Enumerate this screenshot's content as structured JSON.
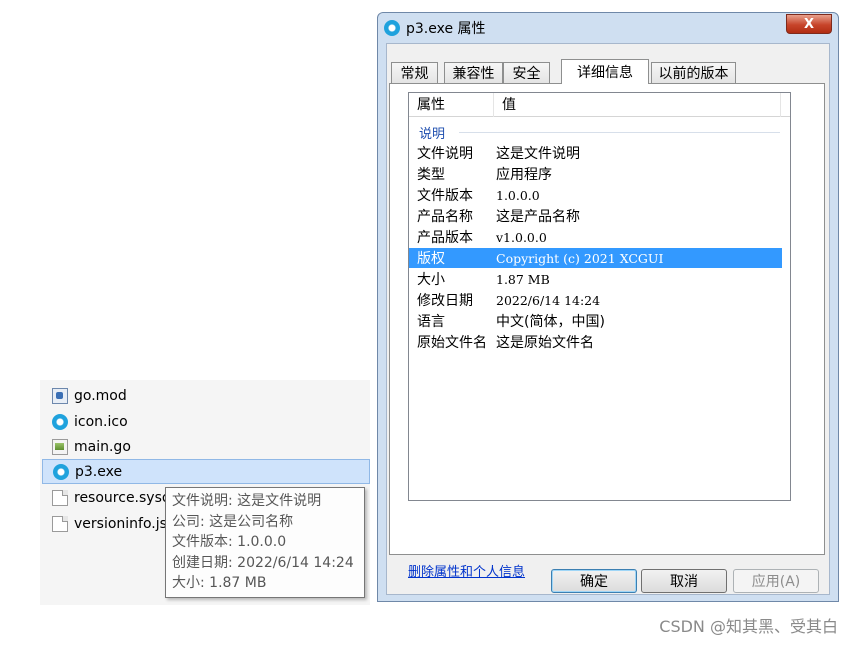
{
  "explorer": {
    "files": [
      {
        "name": "go.mod",
        "icon": "mod-file-icon"
      },
      {
        "name": "icon.ico",
        "icon": "ico-file-icon"
      },
      {
        "name": "main.go",
        "icon": "go-file-icon"
      },
      {
        "name": "p3.exe",
        "icon": "exe-file-icon",
        "selected": true
      },
      {
        "name": "resource.syso",
        "icon": "file-icon"
      },
      {
        "name": "versioninfo.js",
        "icon": "file-icon"
      }
    ],
    "tooltip": {
      "lines": [
        "文件说明: 这是文件说明",
        "公司: 这是公司名称",
        "文件版本: 1.0.0.0",
        "创建日期: 2022/6/14 14:24",
        "大小: 1.87 MB"
      ]
    }
  },
  "dialog": {
    "title": "p3.exe 属性",
    "close_label": "X",
    "tabs": [
      "常规",
      "兼容性",
      "安全",
      "详细信息",
      "以前的版本"
    ],
    "active_tab": "详细信息",
    "columns": {
      "property": "属性",
      "value": "值"
    },
    "section": "说明",
    "rows": [
      {
        "prop": "文件说明",
        "value": "这是文件说明"
      },
      {
        "prop": "类型",
        "value": "应用程序"
      },
      {
        "prop": "文件版本",
        "value": "1.0.0.0"
      },
      {
        "prop": "产品名称",
        "value": "这是产品名称"
      },
      {
        "prop": "产品版本",
        "value": "v1.0.0.0"
      },
      {
        "prop": "版权",
        "value": "Copyright (c) 2021 XCGUI",
        "selected": true
      },
      {
        "prop": "大小",
        "value": "1.87 MB"
      },
      {
        "prop": "修改日期",
        "value": "2022/6/14 14:24"
      },
      {
        "prop": "语言",
        "value": "中文(简体，中国)"
      },
      {
        "prop": "原始文件名",
        "value": "这是原始文件名"
      }
    ],
    "remove_link": "删除属性和个人信息",
    "buttons": {
      "ok": "确定",
      "cancel": "取消",
      "apply": "应用(A)"
    }
  },
  "watermark": "CSDN @知其黑、受其白",
  "colors": {
    "selection": "#3399ff",
    "link": "#0033cc",
    "close_button": "#c7442a"
  }
}
